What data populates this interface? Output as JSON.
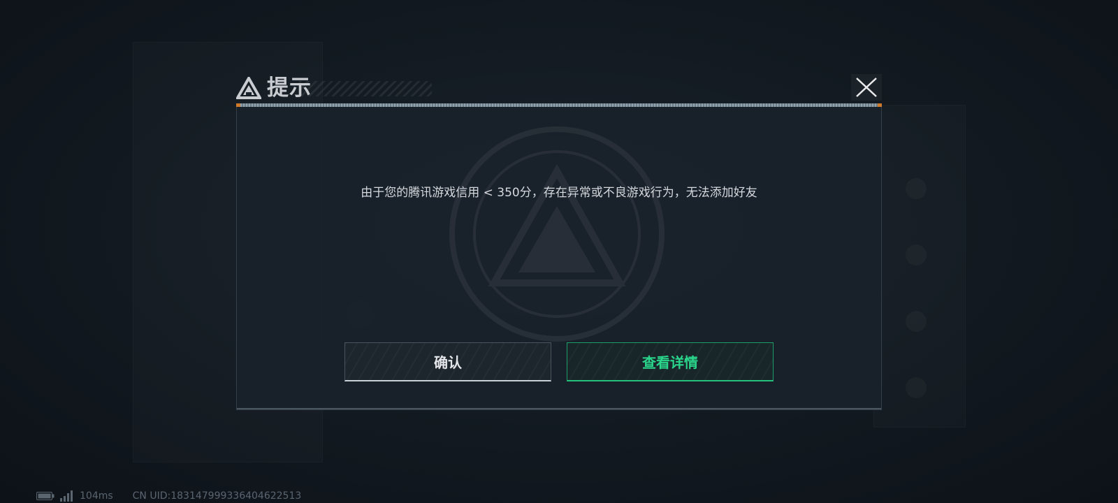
{
  "dialog": {
    "title": "提示",
    "message": "由于您的腾讯游戏信用 < 350分，存在异常或不良游戏行为，无法添加好友",
    "confirm_label": "确认",
    "details_label": "查看详情"
  },
  "status": {
    "ping": "104ms",
    "uid": "CN UID:1831479993364046225​13"
  },
  "icons": {
    "logo": "delta-logo-icon",
    "close": "close-icon",
    "battery": "battery-icon",
    "signal": "signal-icon"
  },
  "colors": {
    "accent_green": "#2ad68b",
    "background": "#0f151c",
    "title_gray": "#c9cdd1"
  }
}
